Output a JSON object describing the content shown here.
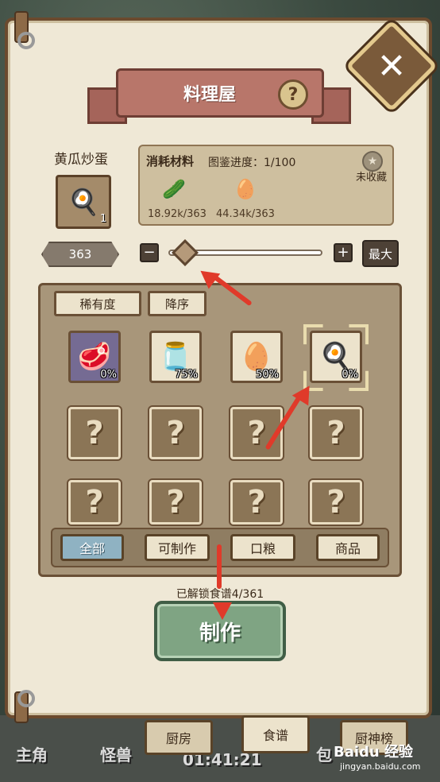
{
  "header": {
    "title": "料理屋",
    "help_icon": "?",
    "close_icon": "✕"
  },
  "dish": {
    "name": "黄瓜炒蛋",
    "count": "1",
    "icon": "🍳"
  },
  "materials": {
    "title": "消耗材料",
    "progress": "图鉴进度：1/100",
    "collect_icon": "★",
    "collect_status": "未收藏",
    "items": [
      {
        "icon_name": "cucumber-icon",
        "icon": "🥒",
        "value": "18.92k/363"
      },
      {
        "icon_name": "egg-icon",
        "icon": "🥚",
        "value": "44.34k/363"
      }
    ]
  },
  "quantity": {
    "value": "363",
    "minus": "−",
    "plus": "+",
    "max_label": "最大",
    "slider_level": 0.05
  },
  "sort": {
    "rarity_label": "稀有度",
    "order_label": "降序"
  },
  "recipes": [
    {
      "icon": "🥩",
      "pct": "0%"
    },
    {
      "icon": "🫙",
      "pct": "75%"
    },
    {
      "icon": "🥚",
      "pct": "50%"
    },
    {
      "icon": "🍳",
      "pct": "0%"
    },
    {
      "unknown": "?"
    },
    {
      "unknown": "?"
    },
    {
      "unknown": "?"
    },
    {
      "unknown": "?"
    },
    {
      "unknown": "?"
    },
    {
      "unknown": "?"
    },
    {
      "unknown": "?"
    },
    {
      "unknown": "?"
    }
  ],
  "filters": [
    "全部",
    "可制作",
    "口粮",
    "商品"
  ],
  "unlock_text": "已解锁食谱4/361",
  "make_label": "制作",
  "bottom_tabs": [
    "厨房",
    "食谱",
    "厨神榜"
  ],
  "hud": {
    "left1": "主角",
    "left2": "怪兽",
    "time": "01:41:21",
    "bag": "包"
  },
  "watermark": {
    "main": "Baidu 经验",
    "sub": "jingyan.baidu.com"
  },
  "colors": {
    "panel": "#efe8d6",
    "frame": "#6b4a2e",
    "accent_green": "#7fa483",
    "ribbon": "#b8766a",
    "annotation_red": "#e03a2a"
  }
}
